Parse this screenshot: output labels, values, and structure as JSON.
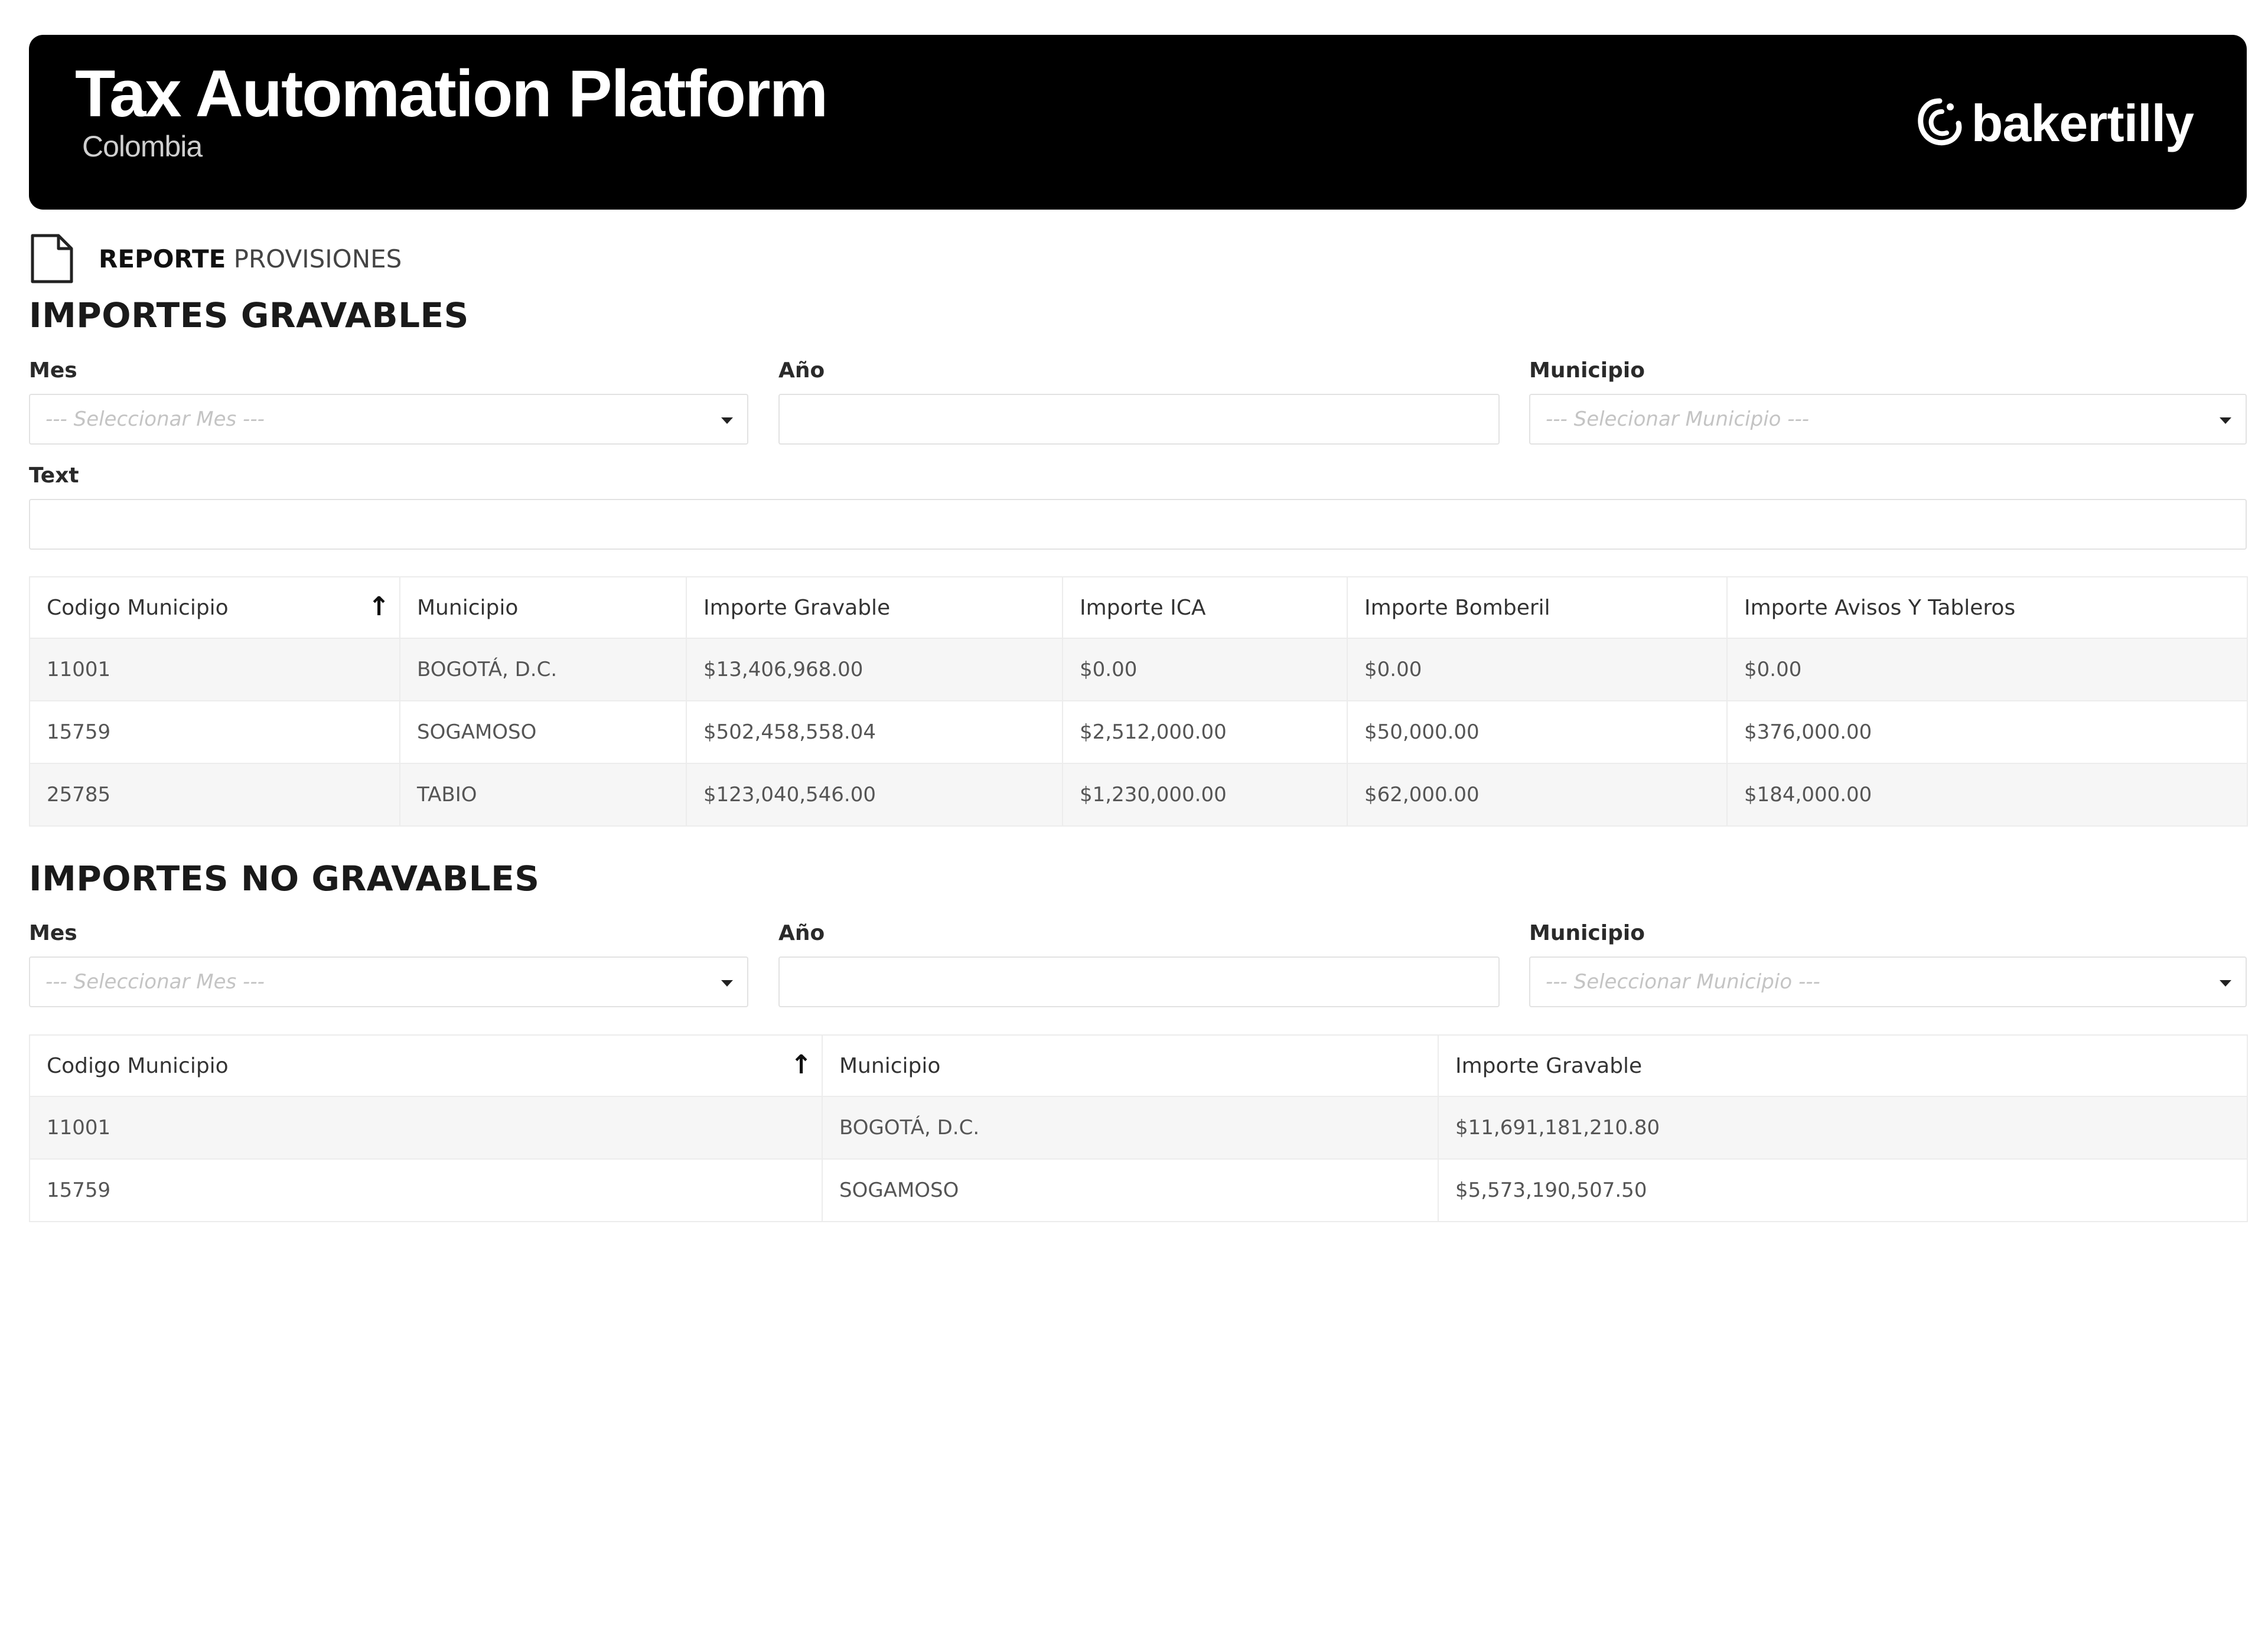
{
  "header": {
    "title": "Tax Automation Platform",
    "subtitle": "Colombia",
    "logo_text": "bakertilly"
  },
  "breadcrumb": {
    "icon": "document-icon",
    "bold": "REPORTE",
    "rest": " PROVISIONES"
  },
  "gravables": {
    "title": "IMPORTES GRAVABLES",
    "mes_label": "Mes",
    "mes_placeholder": "--- Seleccionar Mes ---",
    "anio_label": "Año",
    "municipio_label": "Municipio",
    "municipio_placeholder": "--- Selecionar Municipio ---",
    "text_label": "Text",
    "columns": [
      "Codigo Municipio",
      "Municipio",
      "Importe Gravable",
      "Importe ICA",
      "Importe Bomberil",
      "Importe Avisos Y Tableros"
    ],
    "rows": [
      [
        "11001",
        "BOGOTÁ, D.C.",
        "$13,406,968.00",
        "$0.00",
        "$0.00",
        "$0.00"
      ],
      [
        "15759",
        "SOGAMOSO",
        "$502,458,558.04",
        "$2,512,000.00",
        "$50,000.00",
        "$376,000.00"
      ],
      [
        "25785",
        "TABIO",
        "$123,040,546.00",
        "$1,230,000.00",
        "$62,000.00",
        "$184,000.00"
      ]
    ]
  },
  "no_gravables": {
    "title": "IMPORTES NO GRAVABLES",
    "mes_label": "Mes",
    "mes_placeholder": "--- Seleccionar Mes ---",
    "anio_label": "Año",
    "municipio_label": "Municipio",
    "municipio_placeholder": "--- Seleccionar Municipio ---",
    "columns": [
      "Codigo Municipio",
      "Municipio",
      "Importe Gravable"
    ],
    "rows": [
      [
        "11001",
        "BOGOTÁ, D.C.",
        "$11,691,181,210.80"
      ],
      [
        "15759",
        "SOGAMOSO",
        "$5,573,190,507.50"
      ]
    ]
  },
  "sort_icon": "arrow-up-icon"
}
